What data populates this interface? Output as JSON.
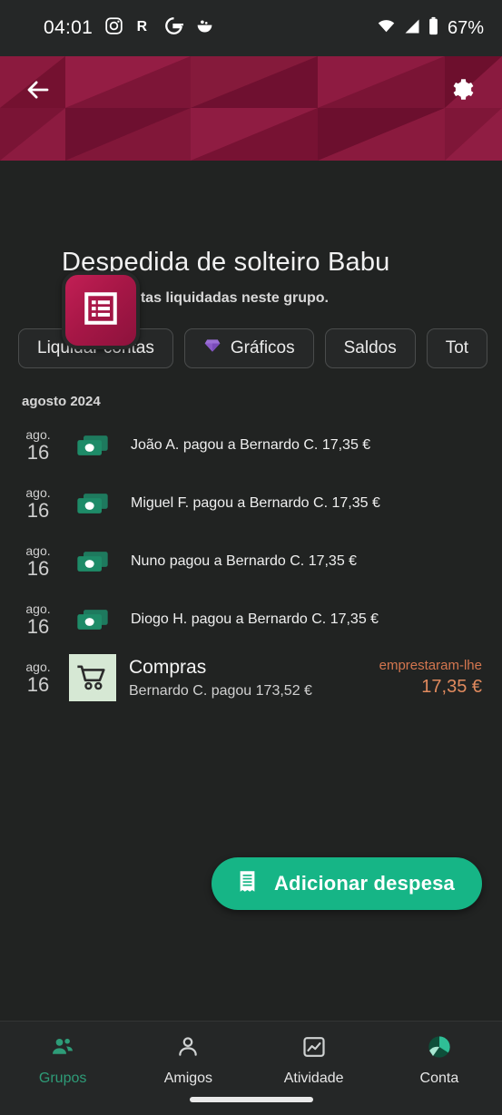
{
  "statusbar": {
    "time": "04:01",
    "icons": [
      "instagram-icon",
      "reddit-icon",
      "google-icon",
      "bowl-icon"
    ],
    "wifi_icon": "wifi-icon",
    "signal_icon": "cellular-signal-icon",
    "battery_icon": "battery-icon",
    "battery_text": "67%"
  },
  "header": {
    "back_icon": "back-arrow-icon",
    "settings_icon": "gear-icon",
    "avatar_icon": "list-icon",
    "banner_color": "#7d1537"
  },
  "group": {
    "title": "Despedida de solteiro Babu",
    "subtitle": "Tem as contas liquidadas neste grupo."
  },
  "chips": [
    {
      "label": "Liquidar contas",
      "icon": null
    },
    {
      "label": "Gráficos",
      "icon": "gem-icon"
    },
    {
      "label": "Saldos",
      "icon": null
    },
    {
      "label": "Tot",
      "icon": null
    }
  ],
  "list": {
    "month_header": "agosto 2024",
    "rows": [
      {
        "type": "payment",
        "month": "ago.",
        "day": "16",
        "icon": "cash-icon",
        "text": "João A. pagou a Bernardo C. 17,35 €"
      },
      {
        "type": "payment",
        "month": "ago.",
        "day": "16",
        "icon": "cash-icon",
        "text": "Miguel F. pagou a Bernardo C. 17,35 €"
      },
      {
        "type": "payment",
        "month": "ago.",
        "day": "16",
        "icon": "cash-icon",
        "text": "Nuno pagou a Bernardo C. 17,35 €"
      },
      {
        "type": "payment",
        "month": "ago.",
        "day": "16",
        "icon": "cash-icon",
        "text": "Diogo H. pagou a Bernardo C. 17,35 €"
      },
      {
        "type": "expense",
        "month": "ago.",
        "day": "16",
        "icon": "shopping-cart-icon",
        "title": "Compras",
        "subtitle": "Bernardo C. pagou 173,52 €",
        "amount_label": "emprestaram-lhe",
        "amount_value": "17,35 €",
        "amount_color": "#e08a5e"
      }
    ]
  },
  "fab": {
    "label": "Adicionar despesa",
    "icon": "receipt-icon",
    "color": "#16b586"
  },
  "bottomnav": {
    "items": [
      {
        "label": "Grupos",
        "icon": "group-people-icon",
        "active": true
      },
      {
        "label": "Amigos",
        "icon": "person-icon",
        "active": false
      },
      {
        "label": "Atividade",
        "icon": "activity-chart-icon",
        "active": false
      },
      {
        "label": "Conta",
        "icon": "account-avatar-icon",
        "active": false
      }
    ],
    "active_color": "#2e9c78"
  }
}
